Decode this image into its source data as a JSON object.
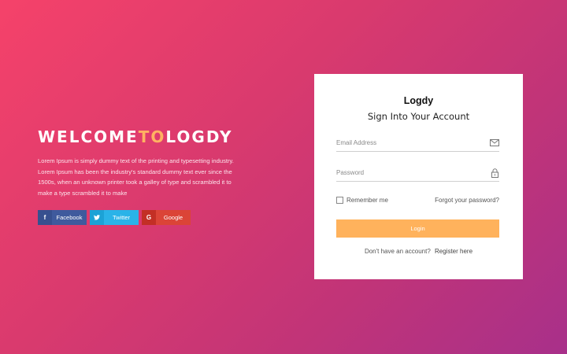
{
  "welcome": {
    "part1": "WELCOME",
    "part2": "TO",
    "part3": "LOGDY",
    "description": "Lorem Ipsum is simply dummy text of the printing and typesetting industry. Lorem Ipsum has been the industry's standard dummy text ever since the 1500s, when an unknown printer took a galley of type and scrambled it to make a type scrambled it to make",
    "accent_color": "#ffb262"
  },
  "social": [
    {
      "label": "Facebook",
      "icon": "f",
      "icon_name": "facebook-icon",
      "color": "#3f5a9d"
    },
    {
      "label": "Twitter",
      "icon": "🐦",
      "icon_name": "twitter-icon",
      "color": "#2ab3e8"
    },
    {
      "label": "Google",
      "icon": "G",
      "icon_name": "google-icon",
      "color": "#db4437"
    }
  ],
  "card": {
    "brand": "Logdy",
    "subtitle": "Sign Into Your Account",
    "email_placeholder": "Email Address",
    "password_placeholder": "Password",
    "remember_label": "Remember me",
    "forgot_label": "Forgot your password?",
    "login_label": "Login",
    "no_account": "Don't have an account?",
    "register_label": "Register here",
    "button_color": "#ffb25c"
  }
}
